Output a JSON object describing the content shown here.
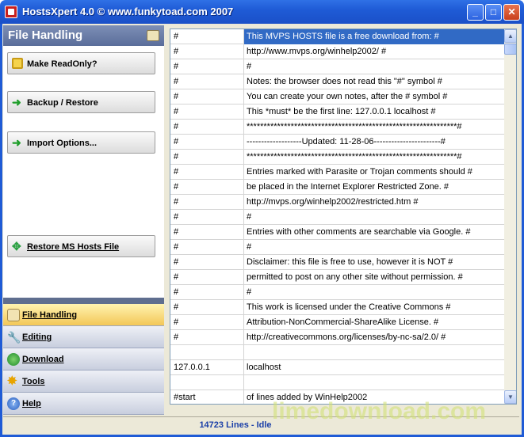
{
  "window": {
    "title": "HostsXpert 4.0 © www.funkytoad.com 2007",
    "minimize_glyph": "_",
    "maximize_glyph": "□",
    "close_glyph": "✕"
  },
  "sidebar": {
    "header": "File Handling",
    "actions": [
      {
        "label": "Make ReadOnly?",
        "icon": "lock-icon"
      },
      {
        "label": "Backup / Restore",
        "icon": "arrow-right-icon"
      },
      {
        "label": "Import Options...",
        "icon": "arrow-right-icon"
      },
      {
        "label": "Restore MS Hosts File",
        "icon": "restore-icon"
      }
    ],
    "nav": [
      {
        "label": "File Handling",
        "icon": "file-handling-icon",
        "active": true
      },
      {
        "label": "Editing",
        "icon": "wrench-icon"
      },
      {
        "label": "Download",
        "icon": "globe-icon"
      },
      {
        "label": "Tools",
        "icon": "star-icon"
      },
      {
        "label": "Help",
        "icon": "help-icon"
      }
    ]
  },
  "grid": {
    "rows": [
      [
        "#",
        "This MVPS HOSTS file is a free download from:         #"
      ],
      [
        "#",
        "http://www.mvps.org/winhelp2002/                 #"
      ],
      [
        "#",
        "#"
      ],
      [
        "#",
        "Notes: the browser does not read this \"#\" symbol       #"
      ],
      [
        "#",
        "You can create your own notes, after the # symbol       #"
      ],
      [
        "#",
        "This *must* be the first line: 127.0.0.1     localhost  #"
      ],
      [
        "#",
        "**************************************************************#"
      ],
      [
        "#",
        "-------------------Updated: 11-28-06-----------------------#"
      ],
      [
        "#",
        "**************************************************************#"
      ],
      [
        "#",
        "Entries marked with Parasite or Trojan comments should  #"
      ],
      [
        "#",
        "be placed in the Internet Explorer Restricted Zone.     #"
      ],
      [
        "#",
        "http://mvps.org/winhelp2002/restricted.htm              #"
      ],
      [
        "#",
        "#"
      ],
      [
        "#",
        "Entries with other comments are searchable via Google.  #"
      ],
      [
        "#",
        "#"
      ],
      [
        "#",
        "Disclaimer: this file is free to use, however it is NOT #"
      ],
      [
        "#",
        "permitted to post on any other site without permission. #"
      ],
      [
        "#",
        "#"
      ],
      [
        "#",
        "This work is licensed under the Creative Commons       #"
      ],
      [
        "#",
        "Attribution-NonCommercial-ShareAlike License.          #"
      ],
      [
        "#",
        "http://creativecommons.org/licenses/by-nc-sa/2.0/      #"
      ],
      [
        "",
        ""
      ],
      [
        "127.0.0.1",
        "localhost"
      ],
      [
        "",
        ""
      ],
      [
        "#start",
        "of lines added by WinHelp2002"
      ]
    ],
    "selected_row": 0
  },
  "status": {
    "text": "14723 Lines - Idle"
  },
  "watermark": "limedownload.com"
}
